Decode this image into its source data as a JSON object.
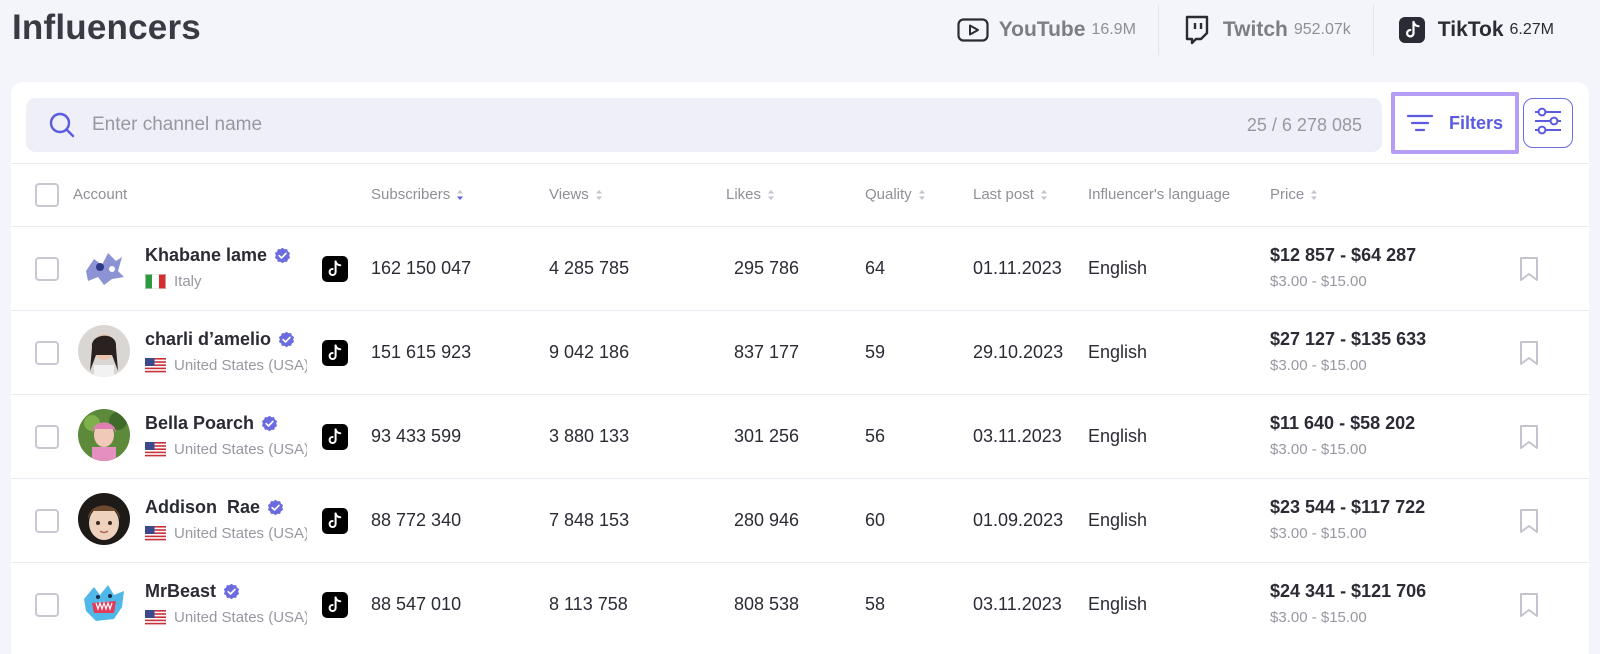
{
  "header": {
    "title": "Influencers"
  },
  "platforms": [
    {
      "name": "YouTube",
      "count": "16.9M",
      "icon": "youtube-icon"
    },
    {
      "name": "Twitch",
      "count": "952.07k",
      "icon": "twitch-icon"
    },
    {
      "name": "TikTok",
      "count": "6.27M",
      "icon": "tiktok-icon"
    }
  ],
  "search": {
    "placeholder": "Enter channel name",
    "value": "",
    "count": "25 / 6 278 085"
  },
  "toolbar": {
    "filters_label": "Filters"
  },
  "table": {
    "columns": {
      "account": "Account",
      "subscribers": "Subscribers",
      "views": "Views",
      "likes": "Likes",
      "quality": "Quality",
      "last_post": "Last post",
      "language": "Influencer's language",
      "price": "Price"
    },
    "rows": [
      {
        "name": "Khabane lame",
        "country": "Italy",
        "flag": "italy",
        "subscribers": "162 150 047",
        "views": "4 285 785",
        "likes": "295 786",
        "quality": "64",
        "last_post": "01.11.2023",
        "language": "English",
        "price": "$12 857 - $64 287",
        "price_per": "$3.00 - $15.00"
      },
      {
        "name": "charli d’amelio",
        "country": "United States (USA)",
        "flag": "usa",
        "subscribers": "151 615 923",
        "views": "9 042 186",
        "likes": "837 177",
        "quality": "59",
        "last_post": "29.10.2023",
        "language": "English",
        "price": "$27 127 - $135 633",
        "price_per": "$3.00 - $15.00"
      },
      {
        "name": "Bella Poarch",
        "country": "United States (USA)",
        "flag": "usa",
        "subscribers": "93 433 599",
        "views": "3 880 133",
        "likes": "301 256",
        "quality": "56",
        "last_post": "03.11.2023",
        "language": "English",
        "price": "$11 640 - $58 202",
        "price_per": "$3.00 - $15.00"
      },
      {
        "name": "Addison  Rae",
        "country": "United States (USA)",
        "flag": "usa",
        "subscribers": "88 772 340",
        "views": "7 848 153",
        "likes": "280 946",
        "quality": "60",
        "last_post": "01.09.2023",
        "language": "English",
        "price": "$23 544 - $117 722",
        "price_per": "$3.00 - $15.00"
      },
      {
        "name": "MrBeast",
        "country": "United States (USA)",
        "flag": "usa",
        "subscribers": "88 547 010",
        "views": "8 113 758",
        "likes": "808 538",
        "quality": "58",
        "last_post": "03.11.2023",
        "language": "English",
        "price": "$24 341 - $121 706",
        "price_per": "$3.00 - $15.00"
      }
    ]
  },
  "colors": {
    "accent": "#5b5be0",
    "highlight": "#b59cf5",
    "background": "#f4f5fb"
  }
}
